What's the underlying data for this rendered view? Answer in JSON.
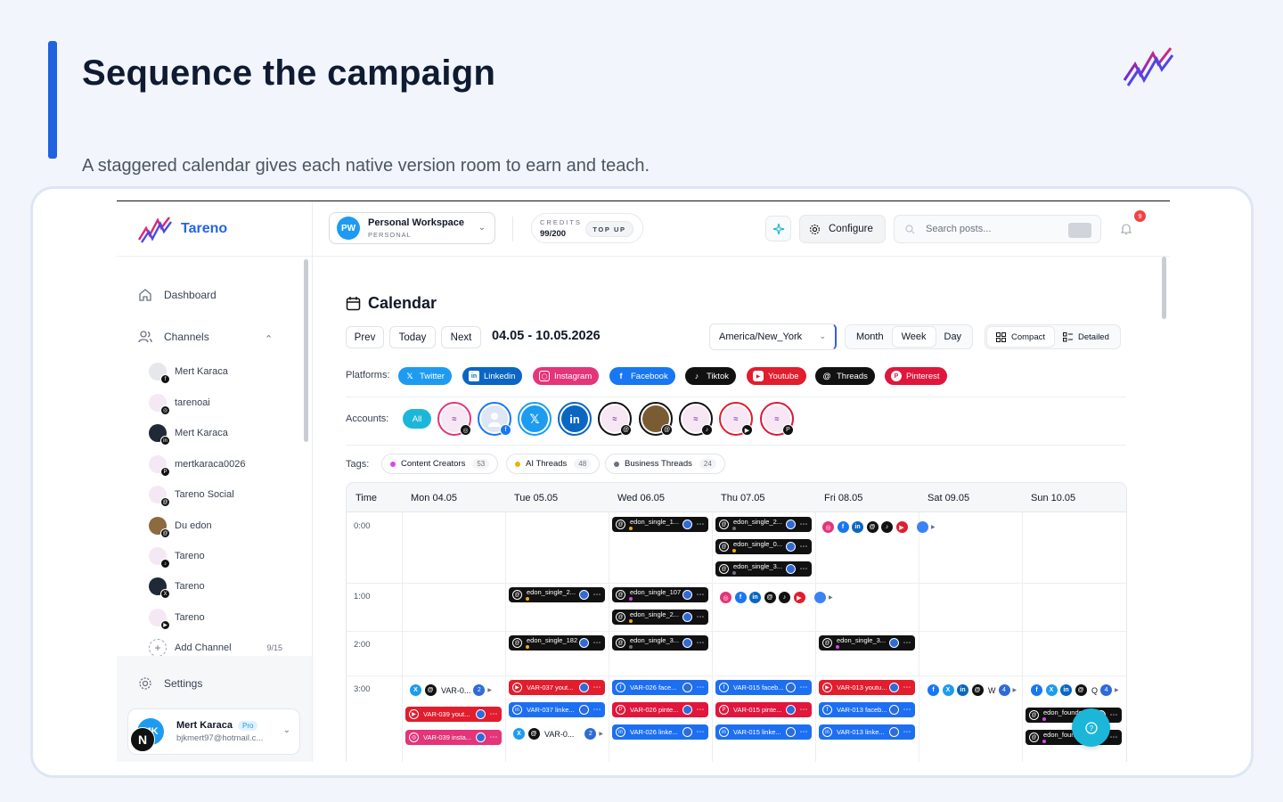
{
  "slide": {
    "title": "Sequence the campaign",
    "subtitle": "A staggered calendar gives each native version room to earn and teach."
  },
  "colors": {
    "accent": "#1f63e0",
    "brand": "#2563eb",
    "teal": "#1cb7d8"
  },
  "sidebar": {
    "brand": "Tareno",
    "nav": {
      "dashboard": "Dashboard",
      "channels": "Channels",
      "settings": "Settings"
    },
    "accounts": [
      {
        "name": "Mert Karaca",
        "platform": "facebook"
      },
      {
        "name": "tarenoai",
        "platform": "instagram"
      },
      {
        "name": "Mert Karaca",
        "platform": "linkedin"
      },
      {
        "name": "mertkaraca0026",
        "platform": "pinterest"
      },
      {
        "name": "Tareno Social",
        "platform": "threads"
      },
      {
        "name": "Du edon",
        "platform": "threads"
      },
      {
        "name": "Tareno",
        "platform": "tiktok"
      },
      {
        "name": "Tareno",
        "platform": "x"
      },
      {
        "name": "Tareno",
        "platform": "youtube"
      }
    ],
    "add_channel": "Add Channel",
    "add_channel_count": "9/15",
    "user": {
      "initials": "MK",
      "name": "Mert Karaca",
      "plan": "Pro",
      "email": "bjkmert97@hotmail.c..."
    },
    "floating_badge": "N"
  },
  "topbar": {
    "workspace": {
      "initials": "PW",
      "name": "Personal Workspace",
      "type": "PERSONAL"
    },
    "credits": {
      "label": "CREDITS",
      "value": "99/200",
      "topup": "TOP UP"
    },
    "configure": "Configure",
    "search_placeholder": "Search posts...",
    "notifications": "9"
  },
  "calendar": {
    "title": "Calendar",
    "nav": {
      "prev": "Prev",
      "today": "Today",
      "next": "Next"
    },
    "date_range": "04.05 - 10.05.2026",
    "timezone": "America/New_York",
    "views": [
      "Month",
      "Week",
      "Day"
    ],
    "active_view": "Week",
    "density": [
      "Compact",
      "Detailed"
    ],
    "platforms_label": "Platforms:",
    "platforms": [
      {
        "name": "Twitter",
        "color": "#1d9bf0"
      },
      {
        "name": "Linkedin",
        "color": "#0a66c2"
      },
      {
        "name": "Instagram",
        "color": "#e4347a"
      },
      {
        "name": "Facebook",
        "color": "#1877f2"
      },
      {
        "name": "Tiktok",
        "color": "#111111"
      },
      {
        "name": "Youtube",
        "color": "#e11d2e"
      },
      {
        "name": "Threads",
        "color": "#111111"
      },
      {
        "name": "Pinterest",
        "color": "#e0163c"
      }
    ],
    "accounts_label": "Accounts:",
    "accounts_all": "All",
    "tags_label": "Tags:",
    "tags": [
      {
        "name": "Content Creators",
        "count": "53",
        "color": "#d946ef"
      },
      {
        "name": "AI Threads",
        "count": "48",
        "color": "#eab308"
      },
      {
        "name": "Business Threads",
        "count": "24",
        "color": "#6b7280"
      }
    ],
    "columns": [
      "Time",
      "Mon 04.05",
      "Tue 05.05",
      "Wed 06.05",
      "Thu 07.05",
      "Fri 08.05",
      "Sat 09.05",
      "Sun 10.05"
    ],
    "times": [
      "0:00",
      "1:00",
      "2:00",
      "3:00"
    ],
    "posts": {
      "wed_0a": "edon_single_1...",
      "thu_0a": "edon_single_2...",
      "thu_0b": "edon_single_0...",
      "thu_0c": "edon_single_3...",
      "tue_1a": "edon_single_2...",
      "wed_1a": "edon_single_107",
      "wed_1b": "edon_single_2...",
      "tue_2a": "edon_single_182",
      "wed_2a": "edon_single_3...",
      "fri_2a": "edon_single_3...",
      "mon_3_var": "VAR-0...",
      "mon_3_count": "2",
      "mon_3a": "VAR-039 yout...",
      "mon_3b": "VAR-039 insta...",
      "tue_3a": "VAR-037 yout...",
      "tue_3b": "VAR-037 linke...",
      "tue_3_var": "VAR-0...",
      "tue_3_count": "2",
      "wed_3a": "VAR-026 face...",
      "wed_3b": "VAR-026 pinte...",
      "wed_3c": "VAR-026 linke...",
      "thu_3a": "VAR-015 faceb...",
      "thu_3b": "VAR-015 pinte...",
      "thu_3c": "VAR-015 linke...",
      "fri_3a": "VAR-013 youtu...",
      "fri_3b": "VAR-013 faceb...",
      "fri_3c": "VAR-013 linke...",
      "sat_3_var": "W",
      "sat_3_count": "4",
      "sun_3_var": "Q",
      "sun_3_count": "4",
      "sun_3a": "edon_founder...",
      "sun_3b": "edon_founder..."
    }
  }
}
